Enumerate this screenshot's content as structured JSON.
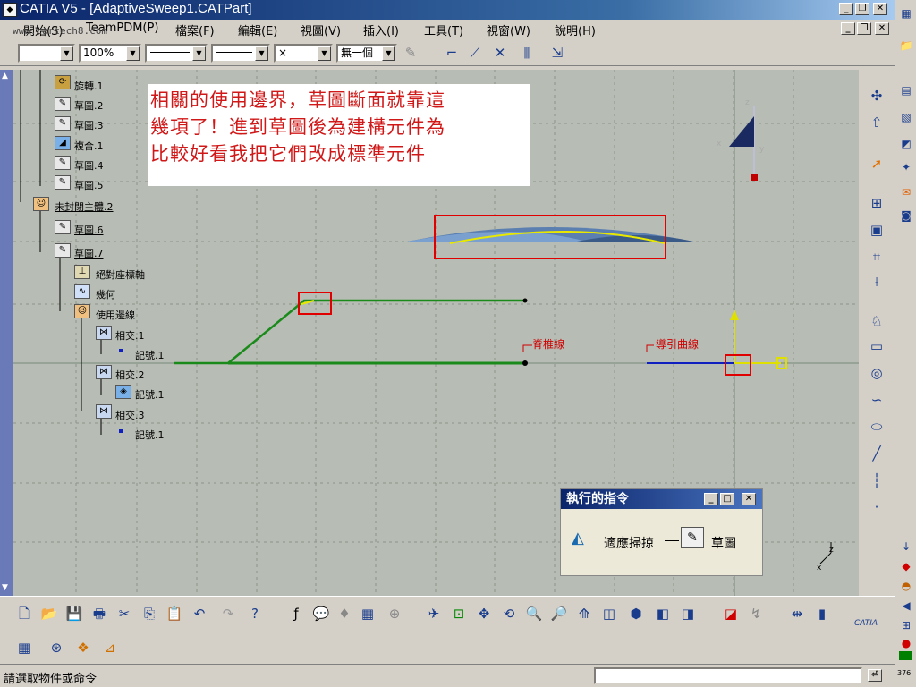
{
  "window": {
    "title": "CATIA V5 - [AdaptiveSweep1.CATPart]",
    "controls": {
      "minimize": "_",
      "restore": "❐",
      "close": "✕"
    }
  },
  "menu": {
    "items": [
      "開始(S)",
      "TeamPDM(P)",
      "檔案(F)",
      "編輯(E)",
      "視圖(V)",
      "插入(I)",
      "工具(T)",
      "視窗(W)",
      "說明(H)"
    ]
  },
  "watermark": "www.cartech8.com",
  "toolbar": {
    "zoom": "100%",
    "linetype_marker": "×",
    "layer": "無一個"
  },
  "tree": {
    "items": [
      {
        "label": "旋轉.1",
        "icon": "rotate-icon"
      },
      {
        "label": "草圖.2",
        "icon": "sketch-icon"
      },
      {
        "label": "草圖.3",
        "icon": "sketch-icon"
      },
      {
        "label": "複合.1",
        "icon": "combine-icon"
      },
      {
        "label": "草圖.4",
        "icon": "sketch-icon"
      },
      {
        "label": "草圖.5",
        "icon": "sketch-icon"
      },
      {
        "label": "未封閉主體.2",
        "icon": "body-icon"
      },
      {
        "label": "草圖.6",
        "icon": "sketch-icon"
      },
      {
        "label": "草圖.7",
        "icon": "sketch-icon"
      },
      {
        "label": "絕對座標軸",
        "icon": "axis-icon"
      },
      {
        "label": "幾何",
        "icon": "geometry-icon"
      },
      {
        "label": "使用邊線",
        "icon": "use-edges-icon"
      },
      {
        "label": "相交.1",
        "icon": "intersect-icon"
      },
      {
        "label": "記號.1",
        "icon": "mark-icon"
      },
      {
        "label": "相交.2",
        "icon": "intersect-icon"
      },
      {
        "label": "記號.1",
        "icon": "mark-icon"
      },
      {
        "label": "相交.3",
        "icon": "intersect-icon"
      },
      {
        "label": "記號.1",
        "icon": "mark-icon"
      }
    ]
  },
  "annotation": {
    "lines": [
      "相關的使用邊界，草圖斷面就靠這",
      "幾項了！進到草圖後為建構元件為",
      "比較好看我把它們改成標準元件"
    ]
  },
  "geometry_labels": {
    "spine": "脊椎線",
    "guide": "導引曲線"
  },
  "command_window": {
    "title": "執行的指令",
    "command": "適應掃掠",
    "sub_command": "草圖"
  },
  "compass": {
    "x": "x",
    "y": "y",
    "z": "z"
  },
  "status": {
    "message": "請選取物件或命令"
  },
  "brand": "CATIA",
  "counter": "376",
  "colors": {
    "title_gradient_start": "#0a246a",
    "canvas_bg": "#b7bcb4",
    "annotation_text": "#d01818",
    "highlight_box": "#e00000",
    "sketch_green": "#1a8a1a",
    "guide_blue": "#1020c0",
    "axis_yellow": "#e0e000"
  }
}
